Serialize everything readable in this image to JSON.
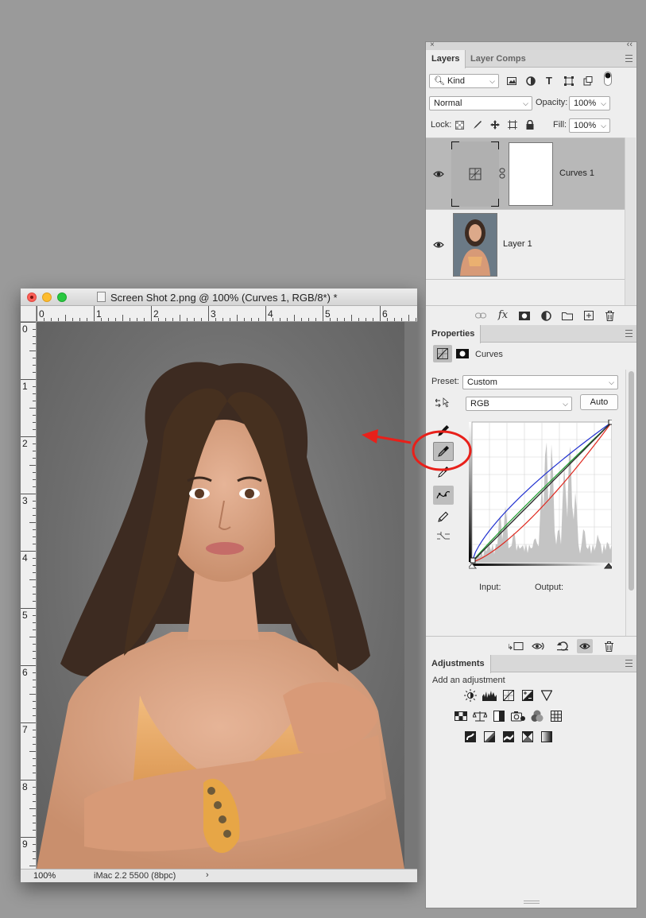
{
  "document": {
    "title": "Screen Shot 2.png @ 100% (Curves 1, RGB/8*) *",
    "zoom": "100%",
    "info": "iMac 2.2 5500 (8bpc)",
    "info_arrow": "›",
    "ruler_top_labels": [
      "0",
      "1",
      "2",
      "3",
      "4",
      "5",
      "6"
    ],
    "ruler_left_labels": [
      "0",
      "1",
      "2",
      "3",
      "4",
      "5",
      "6",
      "7",
      "8",
      "9"
    ]
  },
  "panel_stack": {
    "close_glyph": "×",
    "collapse_glyph": "‹‹"
  },
  "layers_panel": {
    "tabs": [
      {
        "label": "Layers",
        "active": true
      },
      {
        "label": "Layer Comps",
        "active": false
      }
    ],
    "filter_kind": "Kind",
    "blend_mode": "Normal",
    "opacity_label": "Opacity:",
    "opacity_value": "100%",
    "lock_label": "Lock:",
    "fill_label": "Fill:",
    "fill_value": "100%",
    "layers": [
      {
        "name": "Curves 1",
        "selected": true,
        "type": "adjustment"
      },
      {
        "name": "Layer 1",
        "selected": false,
        "type": "pixel"
      }
    ],
    "footer_icons": [
      "link-icon",
      "fx-icon",
      "mask-icon",
      "adjustment-icon",
      "folder-icon",
      "new-layer-icon",
      "trash-icon"
    ],
    "fx_label": "fx"
  },
  "properties_panel": {
    "tab": "Properties",
    "title": "Curves",
    "preset_label": "Preset:",
    "preset_value": "Custom",
    "channel_value": "RGB",
    "auto_label": "Auto",
    "input_label": "Input:",
    "output_label": "Output:",
    "curve_colors": {
      "rgb": "#2a2a2a",
      "red": "#e0281e",
      "green": "#1a9a2a",
      "blue": "#2030d0"
    }
  },
  "adjustments_panel": {
    "tab": "Adjustments",
    "subtitle": "Add an adjustment"
  },
  "annotation": {
    "color": "#e8201a"
  }
}
